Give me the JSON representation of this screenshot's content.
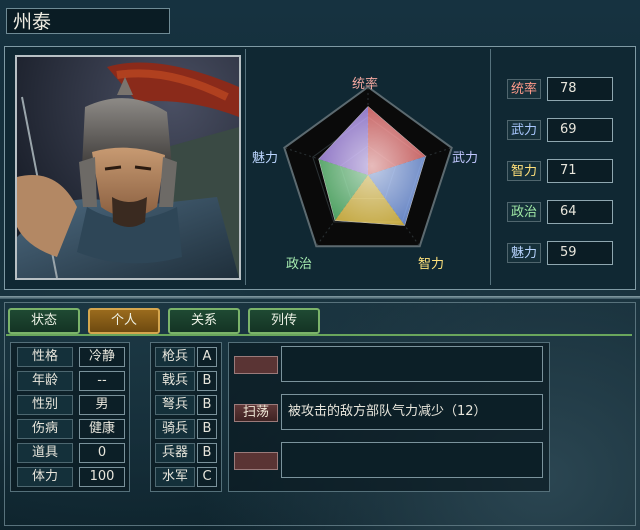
{
  "officer": {
    "name": "州泰"
  },
  "radar": {
    "labels": {
      "top": "统率",
      "right": "武力",
      "bottom_right": "智力",
      "bottom_left": "政治",
      "left": "魅力"
    },
    "max": 100,
    "values": {
      "统率": 78,
      "武力": 69,
      "智力": 71,
      "政治": 64,
      "魅力": 59
    }
  },
  "stats": [
    {
      "label": "统率",
      "value": "78",
      "color": "#ff9a8a"
    },
    {
      "label": "武力",
      "value": "69",
      "color": "#a9c8ff"
    },
    {
      "label": "智力",
      "value": "71",
      "color": "#ffe07a"
    },
    {
      "label": "政治",
      "value": "64",
      "color": "#9fe8a5"
    },
    {
      "label": "魅力",
      "value": "59",
      "color": "#b8d4ff"
    }
  ],
  "tabs": [
    {
      "label": "状态"
    },
    {
      "label": "个人"
    },
    {
      "label": "关系"
    },
    {
      "label": "列传"
    }
  ],
  "personal": [
    {
      "label": "性格",
      "value": "冷静"
    },
    {
      "label": "年龄",
      "value": "--"
    },
    {
      "label": "性别",
      "value": "男"
    },
    {
      "label": "伤病",
      "value": "健康"
    },
    {
      "label": "道具",
      "value": "0"
    },
    {
      "label": "体力",
      "value": "100"
    }
  ],
  "aptitude": [
    {
      "label": "枪兵",
      "value": "A"
    },
    {
      "label": "戟兵",
      "value": "B"
    },
    {
      "label": "弩兵",
      "value": "B"
    },
    {
      "label": "骑兵",
      "value": "B"
    },
    {
      "label": "兵器",
      "value": "B"
    },
    {
      "label": "水军",
      "value": "C"
    }
  ],
  "skills": [
    {
      "name": "",
      "desc": ""
    },
    {
      "name": "扫荡",
      "desc": "被攻击的敌方部队气力减少（12）"
    },
    {
      "name": "",
      "desc": ""
    }
  ]
}
